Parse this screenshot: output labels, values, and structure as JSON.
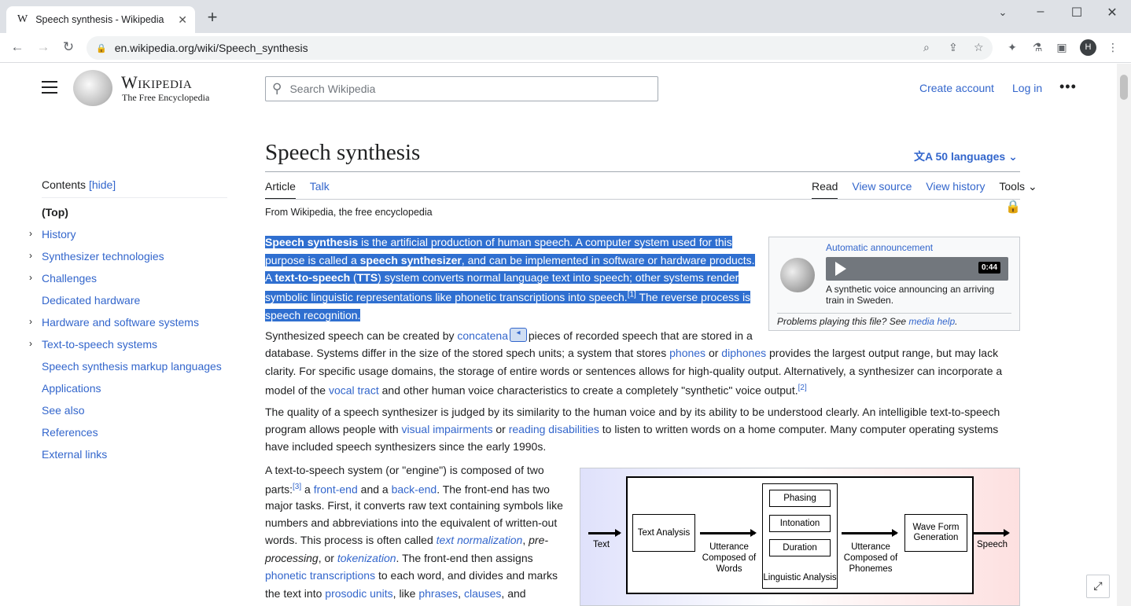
{
  "browser": {
    "tab_title": "Speech synthesis - Wikipedia",
    "tab_favicon": "W",
    "url": "en.wikipedia.org/wiki/Speech_synthesis",
    "profile_initial": "H"
  },
  "header": {
    "wordmark": "Wikipedia",
    "tagline": "The Free Encyclopedia",
    "search_placeholder": "Search Wikipedia",
    "create_account": "Create account",
    "log_in": "Log in",
    "more": "•••"
  },
  "toc": {
    "heading": "Contents",
    "hide": "[hide]",
    "items": [
      {
        "label": "(Top)"
      },
      {
        "label": "History"
      },
      {
        "label": "Synthesizer technologies"
      },
      {
        "label": "Challenges"
      },
      {
        "label": "Dedicated hardware"
      },
      {
        "label": "Hardware and software systems"
      },
      {
        "label": "Text-to-speech systems"
      },
      {
        "label": "Speech synthesis markup languages"
      },
      {
        "label": "Applications"
      },
      {
        "label": "See also"
      },
      {
        "label": "References"
      },
      {
        "label": "External links"
      }
    ]
  },
  "article": {
    "title": "Speech synthesis",
    "languages": "50 languages",
    "tabs": {
      "article": "Article",
      "talk": "Talk",
      "read": "Read",
      "view_source": "View source",
      "view_history": "View history",
      "tools": "Tools"
    },
    "from": "From Wikipedia, the free encyclopedia",
    "lead": {
      "b1": "Speech synthesis",
      "t1": " is the artificial production of human speech. A computer system used for this purpose is called a ",
      "b2": "speech synthesizer",
      "t2": ", and can be implemented in software or hardware products. A ",
      "b3": "text-to-speech",
      "t3": " (",
      "b4": "TTS",
      "t4": ") system converts normal language text into speech; other systems render symbolic linguistic representations like phonetic transcriptions into speech.",
      "ref1": "[1]",
      "t5": " The reverse process is speech recognition."
    },
    "p2": {
      "t1": "Synthesized speech can be created by ",
      "l1": "concatena",
      "t2": " pieces of recorded speech that are stored in a",
      "t3": "database. Systems differ in the size of the stored sp",
      "t3b": "ech units; a system that stores ",
      "l2": "phones",
      "t4": " or ",
      "l3": "diphones",
      "t5": " provides the largest output range, but may lack",
      "t6": "clarity. For specific usage domains, the storage of entire words or sentences allows for high-quality output. Alternatively, a synthesizer can incorporate a",
      "t7": "model of the ",
      "l4": "vocal tract",
      "t8": " and other human voice characteristics to create a completely \"synthetic\" voice output.",
      "ref2": "[2]"
    },
    "p3": {
      "t1": "The quality of a speech synthesizer is judged by its similarity to the human voice and by its ability to be understood clearly. An intelligible text-to-speech",
      "t2": "program allows people with ",
      "l1": "visual impairments",
      "t3": " or ",
      "l2": "reading disabilities",
      "t4": " to listen to written words on a home computer. Many computer operating systems",
      "t5": "have included speech synthesizers since the early 1990s."
    },
    "p4": {
      "t1": "A text-to-speech system (or \"engine\") is composed of two",
      "t2": "parts:",
      "ref3": "[3]",
      "t3": " a ",
      "l1": "front-end",
      "t4": " and a ",
      "l2": "back-end",
      "t5": ". The front-end has two",
      "t6": "major tasks. First, it converts raw text containing symbols like",
      "t7": "numbers and abbreviations into the equivalent of written-out",
      "t8": "words. This process is often called ",
      "l3": "text normalization",
      "t9": ", ",
      "i1": "pre-",
      "i2": "processing",
      "t10": ", or ",
      "l4": "tokenization",
      "t11": ". The front-end then assigns",
      "l5": "phonetic transcriptions",
      "t12": " to each word, and divides and marks",
      "t13": "the text into ",
      "l6": "prosodic units",
      "t14": ", like ",
      "l7": "phrases",
      "t15": ", ",
      "l8": "clauses",
      "t16": ", and"
    }
  },
  "media": {
    "title": "Automatic announcement",
    "duration": "0:44",
    "caption": "A synthetic voice announcing an arriving train in Sweden.",
    "problems": "Problems playing this file? See ",
    "help_link": "media help",
    "problems_end": "."
  },
  "diagram": {
    "text": "Text",
    "text_analysis": "Text Analysis",
    "utt_words": "Utterance Composed of Words",
    "phasing": "Phasing",
    "intonation": "Intonation",
    "duration": "Duration",
    "linguistic": "Linguistic Analysis",
    "utt_phonemes": "Utterance Composed of Phonemes",
    "waveform": "Wave Form Generation",
    "speech": "Speech"
  }
}
